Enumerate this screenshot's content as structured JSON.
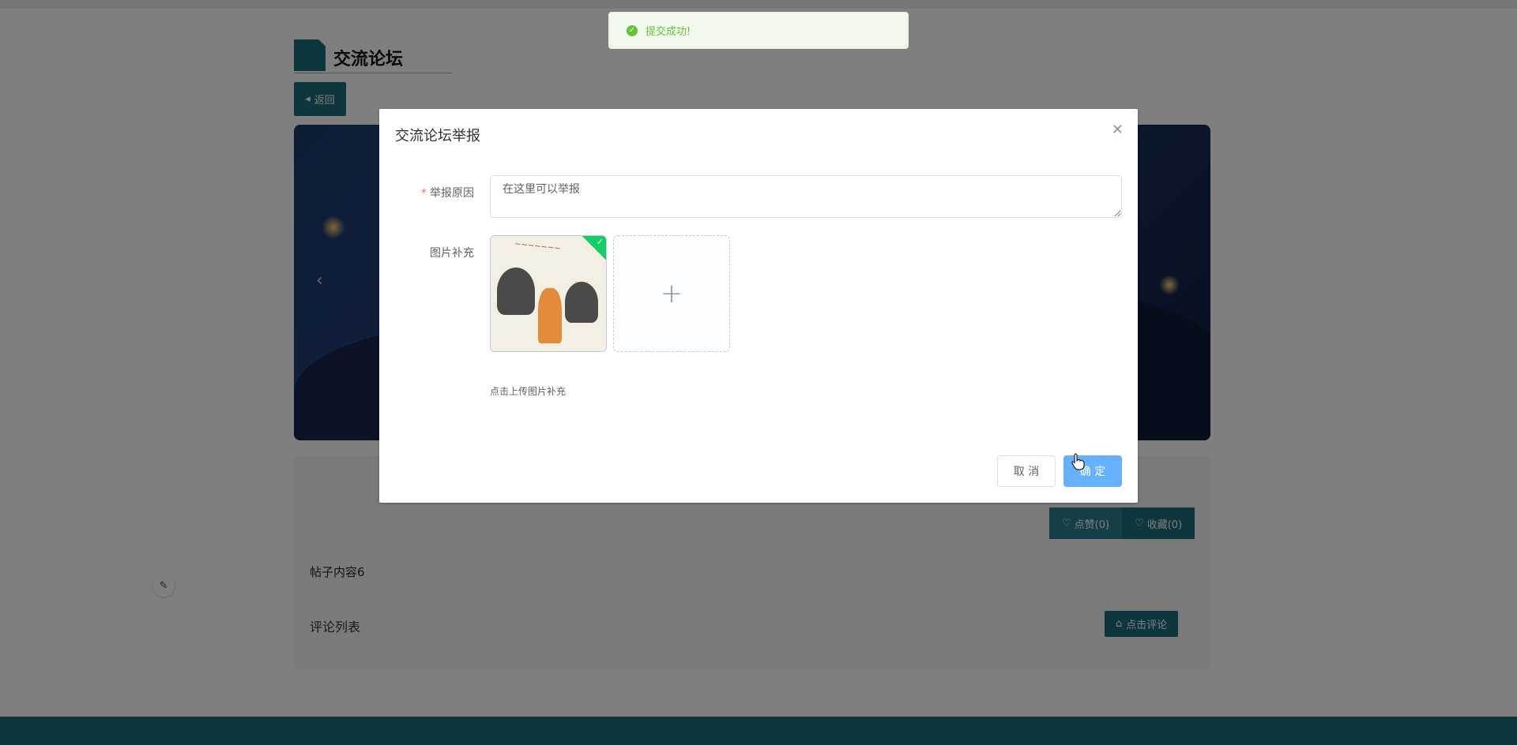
{
  "page": {
    "section_title": "交流论坛",
    "back_label": "返回",
    "post_content": "帖子内容6",
    "like_label": "点赞(0)",
    "favorite_label": "收藏(0)",
    "comments_title": "评论列表",
    "comment_button": "点击评论"
  },
  "toast": {
    "message": "提交成功!",
    "icon": "check-circle-icon",
    "color": "#67c23a"
  },
  "dialog": {
    "title": "交流论坛举报",
    "reason_label": "举报原因",
    "reason_value": "在这里可以举报",
    "image_label": "图片补充",
    "upload_tip": "点击上传图片补充",
    "cancel_label": "取 消",
    "confirm_label": "确 定"
  },
  "colors": {
    "brand": "#1b6c7a",
    "primary_light": "#66b1ff",
    "success": "#13ce66"
  }
}
